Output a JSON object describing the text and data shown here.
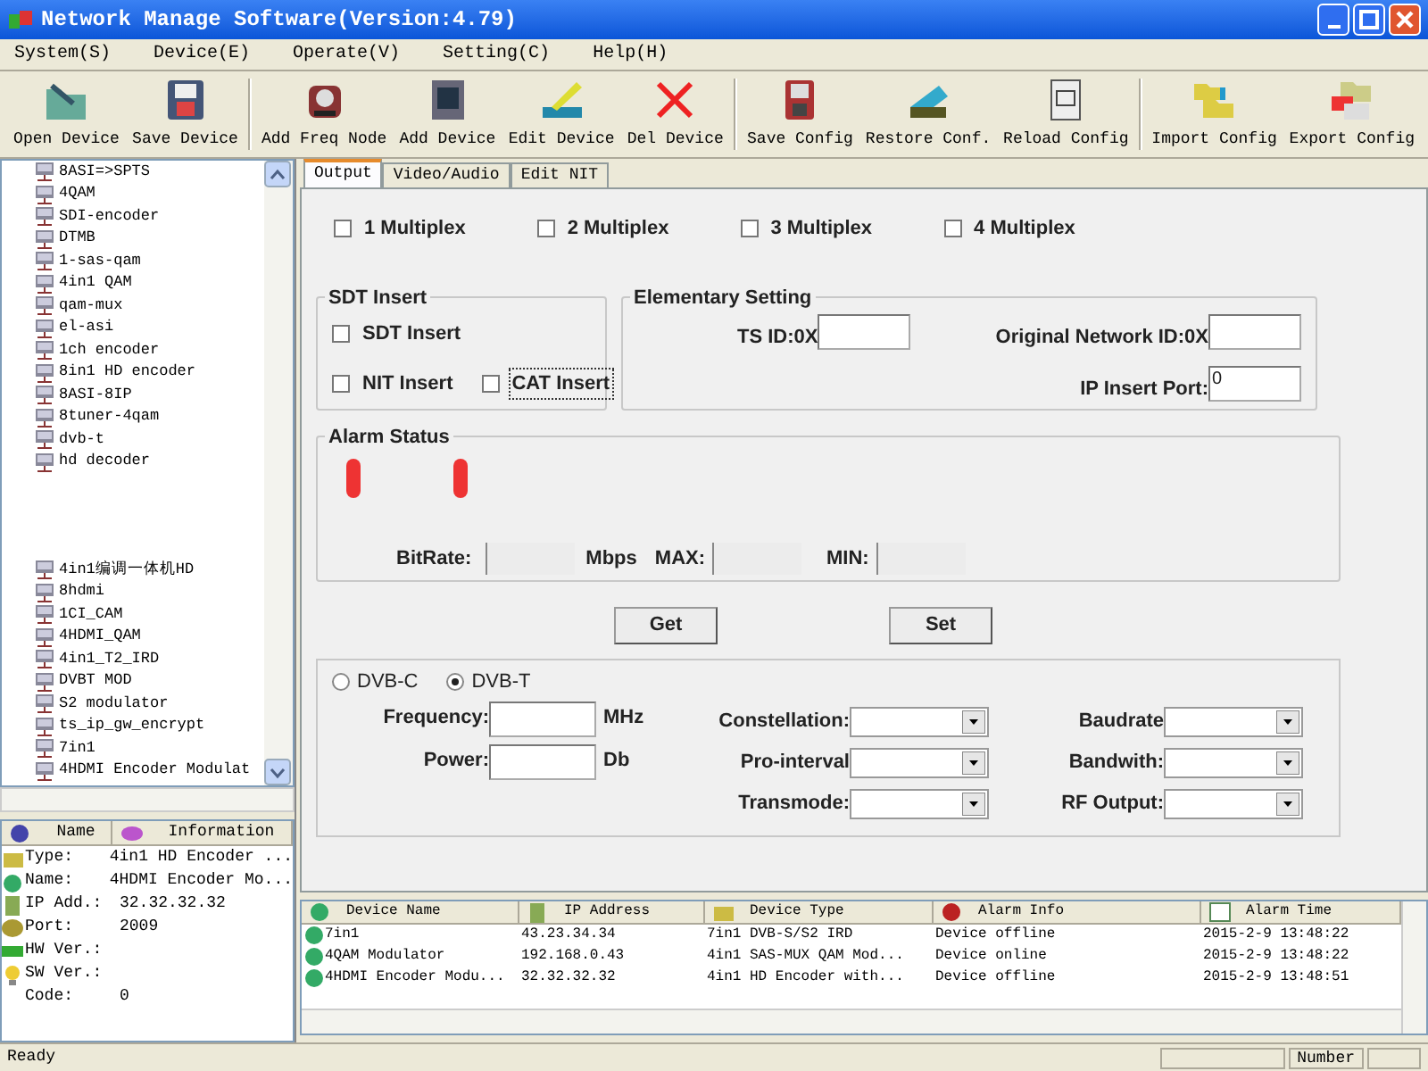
{
  "window": {
    "title": "Network Manage Software(Version:4.79)"
  },
  "menu": [
    "System(S)",
    "Device(E)",
    "Operate(V)",
    "Setting(C)",
    "Help(H)"
  ],
  "toolbar": [
    {
      "label": "Open Device"
    },
    {
      "label": "Save Device"
    },
    {
      "label": "Add Freq Node"
    },
    {
      "label": "Add Device"
    },
    {
      "label": "Edit Device"
    },
    {
      "label": "Del Device"
    },
    {
      "label": "Save Config"
    },
    {
      "label": "Restore Conf."
    },
    {
      "label": "Reload Config"
    },
    {
      "label": "Import Config"
    },
    {
      "label": "Export Config"
    }
  ],
  "tree": {
    "items": [
      {
        "label": "8ASI=>SPTS"
      },
      {
        "label": "4QAM"
      },
      {
        "label": "SDI-encoder"
      },
      {
        "label": "DTMB"
      },
      {
        "label": "1-sas-qam"
      },
      {
        "label": "4in1 QAM"
      },
      {
        "label": "qam-mux"
      },
      {
        "label": "el-asi"
      },
      {
        "label": "1ch encoder"
      },
      {
        "label": "8in1 HD encoder"
      },
      {
        "label": "8ASI-8IP"
      },
      {
        "label": "8tuner-4qam"
      },
      {
        "label": "dvb-t"
      },
      {
        "label": "hd decoder"
      },
      {
        "label": "4in1编调一体机HD",
        "after_gap": true
      },
      {
        "label": "8hdmi"
      },
      {
        "label": "1CI_CAM"
      },
      {
        "label": "4HDMI_QAM"
      },
      {
        "label": "4in1_T2_IRD"
      },
      {
        "label": "DVBT MOD"
      },
      {
        "label": "S2 modulator"
      },
      {
        "label": "ts_ip_gw_encrypt"
      },
      {
        "label": "7in1"
      },
      {
        "label": "4HDMI Encoder Modulat"
      }
    ]
  },
  "info": {
    "columns": [
      "Name",
      "Information"
    ],
    "rows": [
      {
        "name": "Type:",
        "value": "4in1 HD Encoder ..."
      },
      {
        "name": "Name:",
        "value": "4HDMI Encoder Mo..."
      },
      {
        "name": "IP Add.:",
        "value": "32.32.32.32"
      },
      {
        "name": "Port:",
        "value": "2009"
      },
      {
        "name": "HW Ver.:"
      },
      {
        "name": "SW Ver.:"
      },
      {
        "name": "Code:",
        "value": "0"
      }
    ]
  },
  "tabs": [
    {
      "label": "Output",
      "selected": true
    },
    {
      "label": "Video/Audio",
      "selected": false
    },
    {
      "label": "Edit NIT",
      "selected": false
    }
  ],
  "multiplex": [
    {
      "label": "1 Multiplex",
      "checked": false
    },
    {
      "label": "2 Multiplex",
      "checked": false
    },
    {
      "label": "3 Multiplex",
      "checked": false
    },
    {
      "label": "4 Multiplex",
      "checked": false
    }
  ],
  "sdt_insert": {
    "title": "SDT Insert",
    "options": [
      {
        "label": "SDT Insert",
        "checked": false,
        "focused": false
      },
      {
        "label": "NIT Insert",
        "checked": false,
        "focused": false
      },
      {
        "label": "CAT Insert",
        "checked": false,
        "focused": true
      }
    ]
  },
  "elementary_setting": {
    "title": "Elementary Setting",
    "ts_id": {
      "label": "TS ID:0X"
    },
    "original_network_id": {
      "label": "Original Network ID:0X"
    },
    "ip_insert_port": {
      "label": "IP Insert Port:",
      "value": "0"
    }
  },
  "alarm_status": {
    "title": "Alarm Status",
    "bitrate_label": "BitRate:",
    "unit": "Mbps",
    "max_label": "MAX:",
    "min_label": "MIN:"
  },
  "buttons": [
    "Get",
    "Set"
  ],
  "modulation": {
    "radios": [
      {
        "label": "DVB-C",
        "selected": false
      },
      {
        "label": "DVB-T",
        "selected": true
      }
    ],
    "frequency": {
      "label": "Frequency:",
      "unit": "MHz"
    },
    "power": {
      "label": "Power:",
      "unit": "Db"
    },
    "dropdowns": [
      {
        "label": "Constellation:"
      },
      {
        "label": "Baudrate"
      },
      {
        "label": "Pro-interval"
      },
      {
        "label": "Bandwith:"
      },
      {
        "label": "Transmode:"
      },
      {
        "label": "RF Output:"
      }
    ]
  },
  "device_table": {
    "columns": [
      "Device Name",
      "IP Address",
      "Device Type",
      "Alarm Info",
      "Alarm Time"
    ],
    "rows": [
      [
        "7in1",
        "43.23.34.34",
        "7in1 DVB-S/S2 IRD",
        "Device offline",
        "2015-2-9 13:48:22"
      ],
      [
        "4QAM Modulator",
        "192.168.0.43",
        "4in1 SAS-MUX QAM Mod...",
        "Device online",
        "2015-2-9 13:48:22"
      ],
      [
        "4HDMI Encoder Modu...",
        "32.32.32.32",
        "4in1 HD Encoder with...",
        "Device offline",
        "2015-2-9 13:48:51"
      ]
    ]
  },
  "status_bar": {
    "text": "Ready",
    "panel": "Number"
  }
}
